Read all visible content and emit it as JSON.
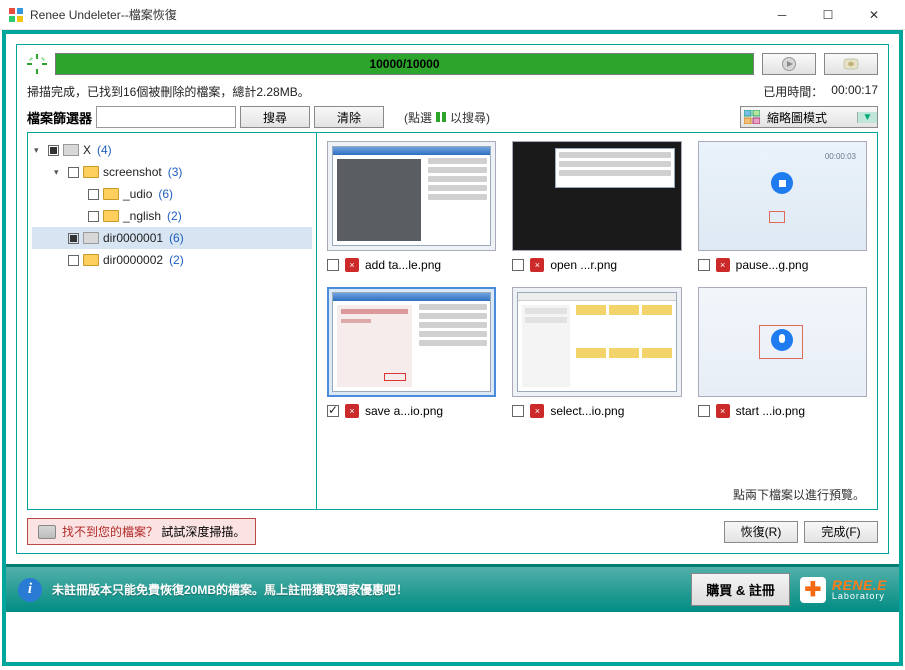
{
  "window": {
    "title": "Renee Undeleter--檔案恢復"
  },
  "progress": {
    "text": "10000/10000"
  },
  "status": {
    "scan_done": "掃描完成，已找到16個被刪除的檔案，總計2.28MB。",
    "elapsed_label": "已用時間：",
    "elapsed_value": "00:00:17"
  },
  "filter": {
    "label": "檔案篩選器",
    "search_btn": "搜尋",
    "clear_btn": "清除",
    "hint_prefix": "(點選",
    "hint_suffix": "以搜尋)",
    "view_label": "縮略圖模式"
  },
  "tree": {
    "root": {
      "name": "X",
      "count": "(4)"
    },
    "screenshot": {
      "name": "screenshot",
      "count": "(3)"
    },
    "udio": {
      "name": "_udio",
      "count": "(6)"
    },
    "nglish": {
      "name": "_nglish",
      "count": "(2)"
    },
    "dir1": {
      "name": "dir0000001",
      "count": "(6)"
    },
    "dir2": {
      "name": "dir0000002",
      "count": "(2)"
    }
  },
  "thumbs": {
    "f1": "add ta...le.png",
    "f2": "open ...r.png",
    "f3": "pause...g.png",
    "f4": "save a...io.png",
    "f5": "select...io.png",
    "f6": "start ...io.png"
  },
  "preview_hint": "點兩下檔案以進行預覽。",
  "deep_scan": {
    "q": "找不到您的檔案？",
    "try": " 試試深度掃描。"
  },
  "actions": {
    "recover": "恢復(R)",
    "finish": "完成(F)"
  },
  "footer": {
    "msg": "未註冊版本只能免費恢復20MB的檔案。馬上註冊獲取獨家優惠吧！",
    "buy": "購買 & 註冊",
    "brand1": "RENE.E",
    "brand2": "Laboratory"
  }
}
